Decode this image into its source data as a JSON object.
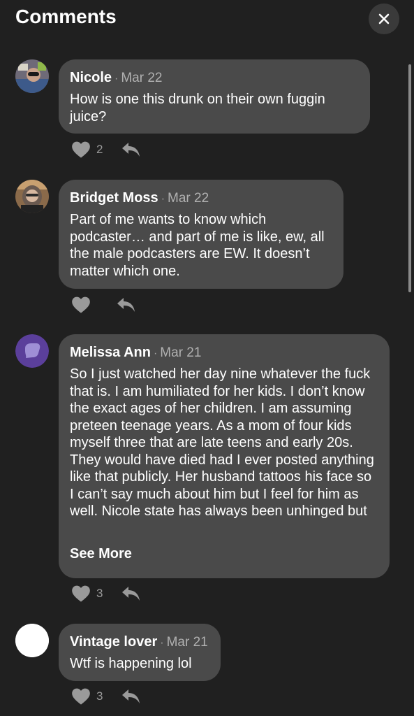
{
  "header": {
    "title": "Comments"
  },
  "comments": [
    {
      "author": "Nicole",
      "date": "Mar 22",
      "text": "How is one this drunk on their own fuggin juice?",
      "likes": "2",
      "avatar": "photo-avatar"
    },
    {
      "author": "Bridget Moss",
      "date": "Mar 22",
      "text": "Part of me wants to know which podcaster… and part of me is like, ew, all the male podcasters are EW. It doesn’t matter which one.",
      "likes": "",
      "avatar": "photo-avatar"
    },
    {
      "author": "Melissa Ann",
      "date": "Mar 21",
      "text": "So I just watched her day nine whatever the fuck that is. I am humiliated for her kids.  I don’t know the exact ages of her children. I am assuming preteen teenage years. As a mom of four kids myself three that are late teens and early 20s. They would have died had I ever posted anything like that publicly. Her husband tattoos his face so I can’t say much about him but I feel for him as well. Nicole state has always been unhinged but",
      "see_more": "See More",
      "likes": "3",
      "avatar": "purple-chat-bubble-avatar"
    },
    {
      "author": "Vintage lover",
      "date": "Mar 21",
      "text": "Wtf is happening lol",
      "likes": "3",
      "avatar": "blank-white-avatar"
    }
  ],
  "colors": {
    "background": "#202020",
    "bubble": "#4a4a4a",
    "icon": "#9a9a9a",
    "accent_purple": "#5b3f9b"
  },
  "icons": [
    "close-icon",
    "heart-icon",
    "reply-arrow-icon"
  ]
}
